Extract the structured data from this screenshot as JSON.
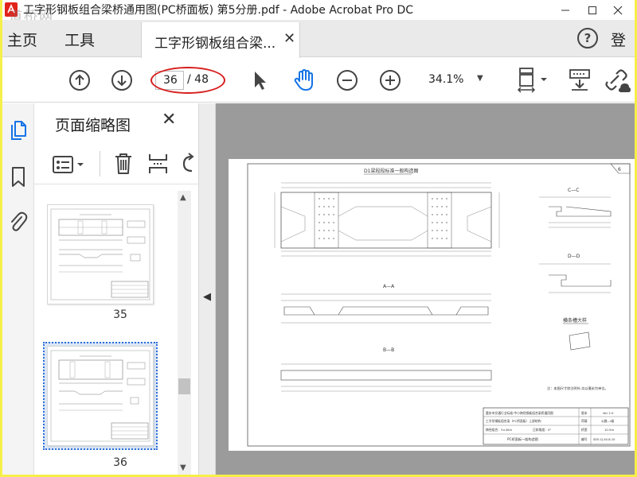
{
  "window": {
    "title": "工字形钢板组合梁桥通用图(PC桥面板) 第5分册.pdf - Adobe Acrobat Pro DC",
    "watermark": "道桥网"
  },
  "tabs": {
    "home": "主页",
    "tools": "工具",
    "document": "工字形钢板组合梁...",
    "signin": "登"
  },
  "toolbar": {
    "current_page": "36",
    "total_pages": "/ 48",
    "zoom": "34.1%"
  },
  "panel": {
    "title": "页面缩略图",
    "thumbnails": [
      {
        "label": "35"
      },
      {
        "label": "36",
        "selected": true
      }
    ]
  },
  "icons": {
    "accent": "#1473e6",
    "rail": [
      "pages-icon",
      "bookmark-icon",
      "attachment-icon"
    ],
    "toolbar": [
      "prev-page-icon",
      "next-page-icon",
      "select-tool-icon",
      "hand-tool-icon",
      "zoom-out-icon",
      "zoom-in-icon",
      "fit-page-icon",
      "scroll-mode-icon",
      "link-icon"
    ]
  },
  "drawing": {
    "title": "D1梁段段标准一般构造图",
    "section_cc": "C—C",
    "section_dd": "D—D",
    "section_aa": "A—A",
    "section_bb": "B—B",
    "detail": "横条槽大样",
    "note": "注：本图尺寸除注明外,均以毫米为单位。",
    "corner": "6",
    "titleblock": {
      "project": "重庆市交通行业标准·中小跨径钢板组合梁桥通用图",
      "subtitle": "工字形钢板组合梁（PC桥面板）上部结构",
      "span": "跨径组合：3×40m",
      "skew": "正斜角度：0°",
      "name": "PC桥面板一般构造图",
      "version_label": "版本",
      "version": "Ver 2.0",
      "load_label": "荷载",
      "load": "公路—I级",
      "width_label": "桥宽",
      "width": "10.5m",
      "code_label": "编号",
      "code": "SD5-CJ-40-8-10"
    }
  }
}
